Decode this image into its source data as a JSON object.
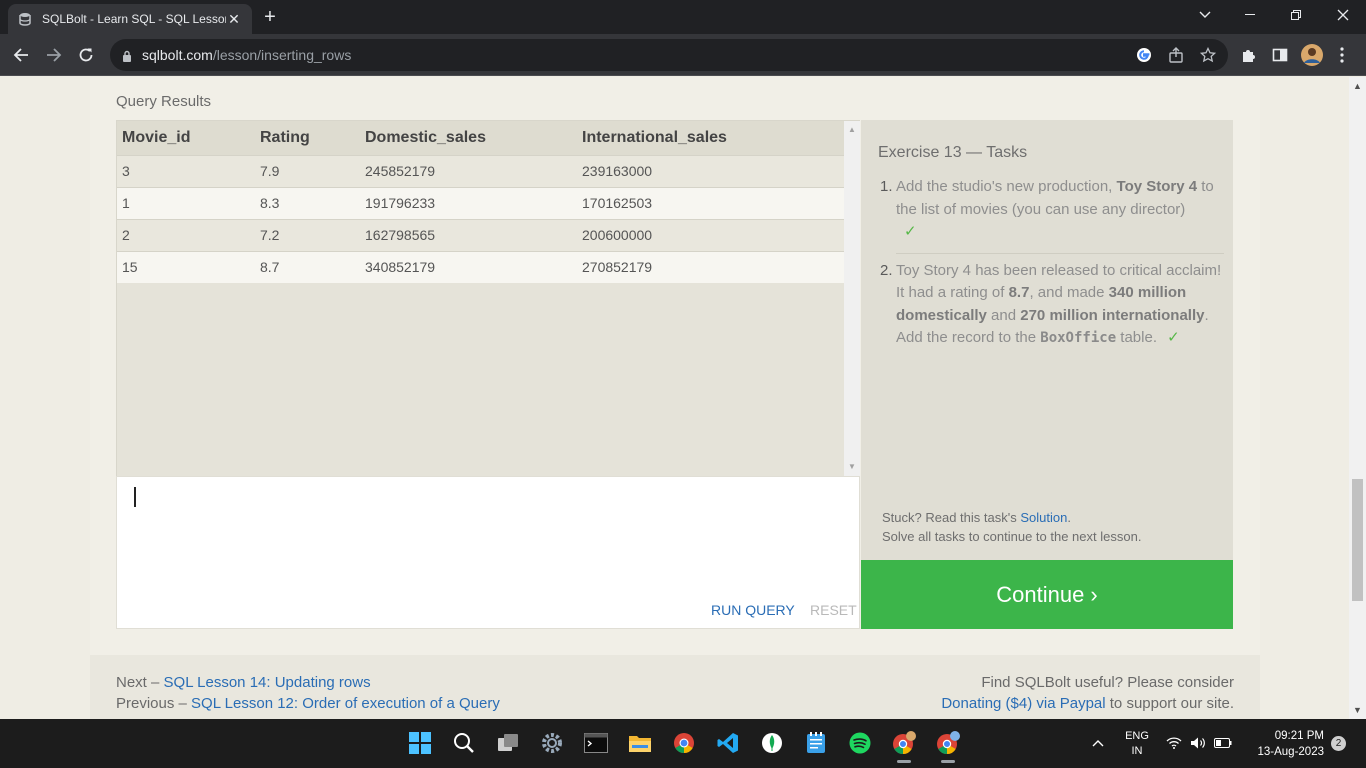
{
  "browser": {
    "tab_title": "SQLBolt - Learn SQL - SQL Lesson",
    "url_host": "sqlbolt.com",
    "url_path": "/lesson/inserting_rows"
  },
  "results": {
    "label": "Query Results",
    "columns": [
      "Movie_id",
      "Rating",
      "Domestic_sales",
      "International_sales"
    ],
    "rows": [
      [
        "3",
        "7.9",
        "245852179",
        "239163000"
      ],
      [
        "1",
        "8.3",
        "191796233",
        "170162503"
      ],
      [
        "2",
        "7.2",
        "162798565",
        "200600000"
      ],
      [
        "15",
        "8.7",
        "340852179",
        "270852179"
      ]
    ]
  },
  "editor": {
    "run_label": "RUN QUERY",
    "reset_label": "RESET"
  },
  "tasks": {
    "title": "Exercise 13 — Tasks",
    "t1": {
      "num": "1.",
      "pre": "Add the studio's new production, ",
      "bold": "Toy Story 4",
      "post": " to the list of movies (you can use any director)",
      "check": "✓"
    },
    "t2": {
      "num": "2.",
      "a": "Toy Story 4 has been released to critical acclaim! It had a rating of ",
      "b": "8.7",
      "c": ", and made ",
      "d": "340 million domestically",
      "e": " and ",
      "f": "270 million internationally",
      "g": ". Add the record to the ",
      "code": "BoxOffice",
      "h": " table.",
      "check": "✓"
    },
    "stuck_text": "Stuck? Read this task's ",
    "solution_link": "Solution",
    "stuck_end": ".",
    "solve_all": "Solve all tasks to continue to the next lesson."
  },
  "continue_label": "Continue ›",
  "footer": {
    "next_prefix": "Next – ",
    "next_link": "SQL Lesson 14: Updating rows",
    "prev_prefix": "Previous – ",
    "prev_link": "SQL Lesson 12: Order of execution of a Query",
    "find_text": "Find SQLBolt useful? Please consider",
    "donate_link": "Donating ($4) via Paypal",
    "donate_suffix": " to support our site."
  },
  "taskbar": {
    "lang_1": "ENG",
    "lang_2": "IN",
    "time": "09:21 PM",
    "date": "13-Aug-2023",
    "notifications": "2"
  }
}
